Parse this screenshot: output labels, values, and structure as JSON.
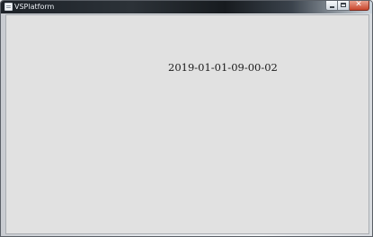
{
  "window": {
    "title": "VSPlatform",
    "icon": "application-icon",
    "controls": {
      "minimize_icon": "minimize-icon",
      "maximize_icon": "maximize-icon",
      "close_icon": "close-icon",
      "close_glyph": "✕"
    }
  },
  "content": {
    "timestamp": "2019-01-01-09-00-02"
  },
  "colors": {
    "client_background": "#e1e1e1",
    "close_button": "#c8452c"
  }
}
